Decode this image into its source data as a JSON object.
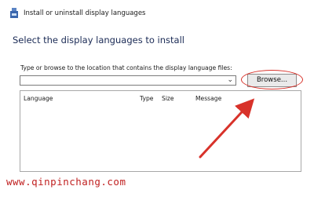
{
  "window": {
    "title": "Install or uninstall display languages",
    "icon": "language-settings-icon"
  },
  "page": {
    "heading": "Select the display languages to install"
  },
  "path_field": {
    "label": "Type or browse to the location that contains the display language files:",
    "value": "",
    "dropdown_icon": "chevron-down-icon"
  },
  "browse_button": {
    "label": "Browse..."
  },
  "language_table": {
    "columns": [
      "Language",
      "Type",
      "Size",
      "Message"
    ],
    "rows": []
  },
  "annotation": {
    "color": "#d8322a"
  },
  "watermark": {
    "text": "www.qinpinchang.com",
    "color": "#c02020"
  }
}
